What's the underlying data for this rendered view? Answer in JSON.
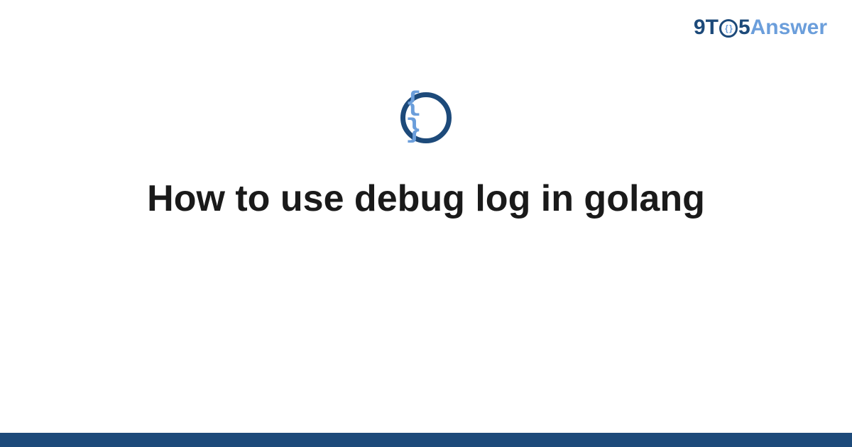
{
  "header": {
    "logo": {
      "part1": "9T",
      "part2": "5",
      "part3": "Answer",
      "circle_content": "{ }"
    }
  },
  "main": {
    "icon_braces": "{ }",
    "title": "How to use debug log in golang"
  },
  "colors": {
    "primary_dark": "#1d4a7a",
    "primary_light": "#6b9edb",
    "text": "#1a1a1a",
    "background": "#ffffff"
  }
}
